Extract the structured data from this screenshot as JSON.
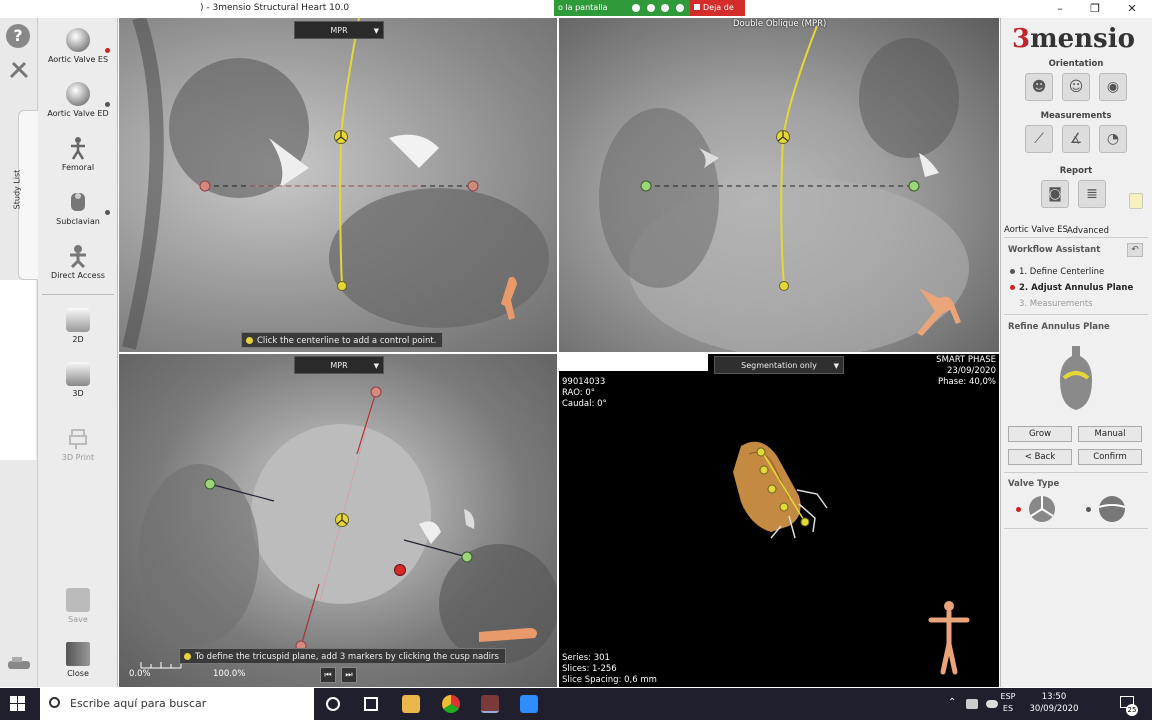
{
  "window": {
    "title": ") - 3mensio Structural Heart 10.0",
    "share_text": "o la pantalla",
    "stop_share": "Deja de",
    "controls": {
      "minimize": "–",
      "maximize": "❐",
      "close": "✕"
    }
  },
  "left_toolbar": {
    "help": "?",
    "study_list": "Study List"
  },
  "workflows": [
    {
      "label": "Aortic Valve ES",
      "icon": "valve-icon",
      "status": "red"
    },
    {
      "label": "Aortic Valve ED",
      "icon": "valve-icon",
      "status": "gray"
    },
    {
      "label": "Femoral",
      "icon": "body-icon",
      "status": "none"
    },
    {
      "label": "Subclavian",
      "icon": "torso-icon",
      "status": "gray"
    },
    {
      "label": "Direct Access",
      "icon": "figure-icon",
      "status": "none"
    }
  ],
  "view_modes": [
    {
      "label": "2D"
    },
    {
      "label": "3D"
    },
    {
      "label": "3D Print"
    }
  ],
  "bottom_actions": [
    {
      "label": "Save"
    },
    {
      "label": "Close"
    }
  ],
  "viewports": {
    "top_left": {
      "label": "MPR",
      "hint": "Click the centerline to add a control point."
    },
    "top_right": {
      "label": "Double Oblique (MPR)"
    },
    "bottom_left": {
      "label": "MPR",
      "hint": "To define the tricuspid plane, add 3 markers by clicking the cusp nadirs",
      "window_min": "0.0%",
      "window_max": "100.0%"
    },
    "bottom_right": {
      "dropdown": "Segmentation only",
      "info_left": [
        "99014033",
        "RAO: 0°",
        "Caudal: 0°"
      ],
      "info_right": [
        "SMART PHASE",
        "23/09/2020",
        "Phase: 40,0%"
      ],
      "series_info": [
        "Series: 301",
        "Slices: 1-256",
        "Slice Spacing: 0,6 mm"
      ]
    }
  },
  "right_panel": {
    "logo_number": "3",
    "logo_text": "mensio",
    "sections": {
      "orientation": "Orientation",
      "measurements": "Measurements",
      "report": "Report"
    },
    "tabs": [
      "Aortic Valve ES",
      "Advanced"
    ],
    "workflow_assistant": {
      "title": "Workflow Assistant",
      "steps": [
        {
          "label": "1. Define Centerline",
          "state": "done"
        },
        {
          "label": "2. Adjust Annulus Plane",
          "state": "active"
        },
        {
          "label": "3. Measurements",
          "state": "disabled"
        }
      ]
    },
    "refine": {
      "title": "Refine Annulus Plane",
      "buttons": [
        "Grow",
        "Manual",
        "< Back",
        "Confirm"
      ]
    },
    "valve_type": {
      "title": "Valve Type"
    }
  },
  "taskbar": {
    "search_placeholder": "Escribe aquí para buscar",
    "lang": [
      "ESP",
      "ES"
    ],
    "time": "13:50",
    "date": "30/09/2020",
    "notifications": "25"
  }
}
